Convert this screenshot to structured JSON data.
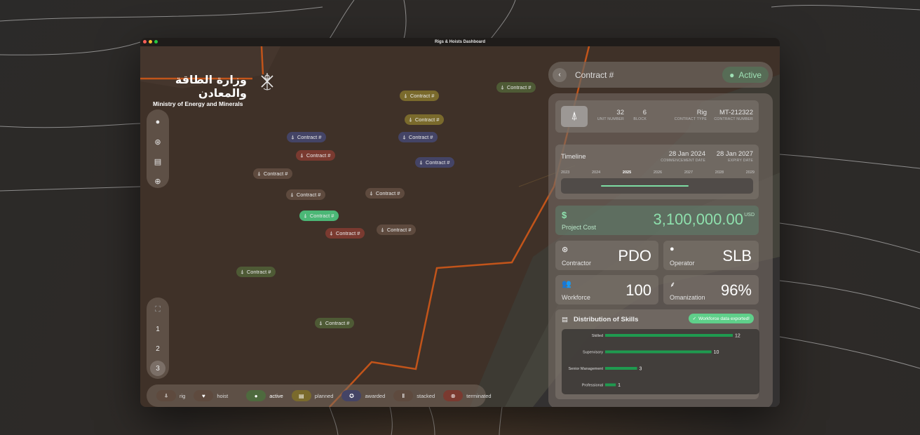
{
  "window": {
    "title": "Rigs & Hoists Dashboard"
  },
  "branding": {
    "arabic_name": "وزارة الطاقة والمعادن",
    "english_name": "Ministry of Energy and Minerals"
  },
  "tools": [
    {
      "name": "drop-icon",
      "glyph": "💧"
    },
    {
      "name": "gauge-icon",
      "glyph": "⊛"
    },
    {
      "name": "calendar-icon",
      "glyph": "▤"
    },
    {
      "name": "zoom-icon",
      "glyph": "⊕"
    }
  ],
  "pages": [
    "1",
    "2",
    "3"
  ],
  "pins": [
    {
      "label": "Contract #",
      "status": "planned",
      "color": "#7a6a2c"
    },
    {
      "label": "Contract #",
      "status": "active",
      "color": "#4e5a35"
    },
    {
      "label": "Contract #",
      "status": "planned",
      "color": "#7a6a2c"
    },
    {
      "label": "Contract #",
      "status": "awarded",
      "color": "#444466"
    },
    {
      "label": "Contract #",
      "status": "awarded",
      "color": "#444466"
    },
    {
      "label": "Contract #",
      "status": "terminated",
      "color": "#7a3a30"
    },
    {
      "label": "Contract #",
      "status": "awarded",
      "color": "#444466"
    },
    {
      "label": "Contract #",
      "status": "stacked",
      "color": "#5e4a3e"
    },
    {
      "label": "Contract #",
      "status": "stacked",
      "color": "#5e4a3e"
    },
    {
      "label": "Contract #",
      "status": "stacked",
      "color": "#5e4a3e"
    },
    {
      "label": "Contract #",
      "status": "active-selected",
      "color": "#4bb776"
    },
    {
      "label": "Contract #",
      "status": "stacked",
      "color": "#5e4a3e"
    },
    {
      "label": "Contract #",
      "status": "terminated",
      "color": "#7a3a30"
    },
    {
      "label": "Contract #",
      "status": "active",
      "color": "#4e5a35"
    },
    {
      "label": "Contract #",
      "status": "active",
      "color": "#4e5a35"
    }
  ],
  "legend": {
    "rig": "rig",
    "hoist": "hoist",
    "active": "active",
    "planned": "planned",
    "awarded": "awarded",
    "stacked": "stacked",
    "terminated": "terminated"
  },
  "detail": {
    "title": "Contract #",
    "status": "Active",
    "unit_number": "32",
    "unit_number_label": "UNIT NUMBER",
    "block": "6",
    "block_label": "BLOCK",
    "contract_type": "Rig",
    "contract_type_label": "CONTRACT TYPE",
    "contract_number": "MT-212322",
    "contract_number_label": "CONTRACT NUMBER",
    "timeline_label": "Timeline",
    "commencement_date": "28 Jan 2024",
    "commencement_label": "COMMENCEMENT DATE",
    "expiry_date": "28 Jan 2027",
    "expiry_label": "EXPIRY DATE",
    "years": [
      "2023",
      "2024",
      "2025",
      "2026",
      "2027",
      "2028",
      "2029"
    ],
    "current_year": "2025",
    "cost_symbol": "$",
    "cost_label": "Project Cost",
    "cost_value": "3,100,000.00",
    "cost_unit": "USD",
    "contractor_label": "Contractor",
    "contractor_value": "PDO",
    "operator_label": "Operator",
    "operator_value": "SLB",
    "workforce_label": "Workforce",
    "workforce_value": "100",
    "omanization_label": "Omanization",
    "omanization_value": "96%",
    "skills_title": "Distribution of Skills",
    "export_badge": "Workforce data exported!"
  },
  "chart_data": {
    "type": "bar",
    "orientation": "horizontal",
    "categories": [
      "Skilled",
      "Supervisory",
      "Senior Management",
      "Professional"
    ],
    "values": [
      12,
      10,
      3,
      1
    ],
    "color": "#1f9a4f"
  },
  "colors": {
    "accent": "#7ddca3",
    "route": "#c2541a"
  }
}
